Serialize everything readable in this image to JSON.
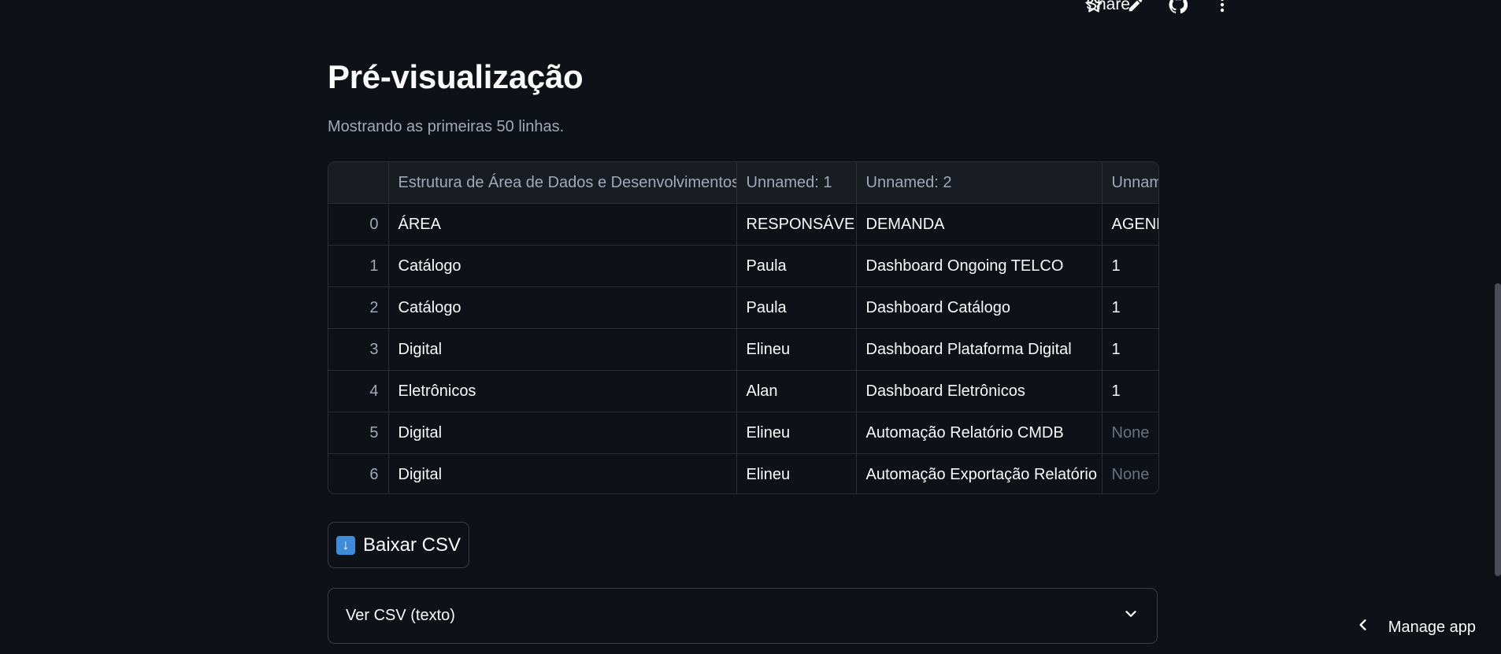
{
  "toolbar": {
    "share_label": "Share",
    "icons": [
      "star-icon",
      "pencil-icon",
      "github-icon",
      "more-vertical-icon"
    ]
  },
  "page": {
    "title": "Pré-visualização",
    "caption": "Mostrando as primeiras 50 linhas."
  },
  "table": {
    "columns": [
      "",
      "Estrutura de Área de Dados e Desenvolvimentos",
      "Unnamed: 1",
      "Unnamed: 2",
      "Unnam"
    ],
    "rows": [
      [
        "0",
        "ÁREA",
        "RESPONSÁVEL",
        "DEMANDA",
        "AGEND"
      ],
      [
        "1",
        "Catálogo",
        "Paula",
        "Dashboard Ongoing TELCO",
        "1"
      ],
      [
        "2",
        "Catálogo",
        "Paula",
        "Dashboard Catálogo",
        "1"
      ],
      [
        "3",
        "Digital",
        "Elineu",
        "Dashboard Plataforma Digital",
        "1"
      ],
      [
        "4",
        "Eletrônicos",
        "Alan",
        "Dashboard Eletrônicos",
        "1"
      ],
      [
        "5",
        "Digital",
        "Elineu",
        "Automação Relatório CMDB",
        "None"
      ],
      [
        "6",
        "Digital",
        "Elineu",
        "Automação Exportação Relatório",
        "None"
      ]
    ]
  },
  "download_button": {
    "icon": "download-arrow-icon",
    "label": "Baixar CSV"
  },
  "expander": {
    "label": "Ver CSV (texto)",
    "icon": "chevron-down-icon"
  },
  "manage_app": {
    "label": "Manage app",
    "icon": "chevron-left-icon"
  },
  "colors": {
    "background": "#0e1117",
    "header_bg": "#1a1c24",
    "border": "#2a2d36",
    "muted_text": "#a3a8b8",
    "accent_blue": "#3d8bd9"
  }
}
